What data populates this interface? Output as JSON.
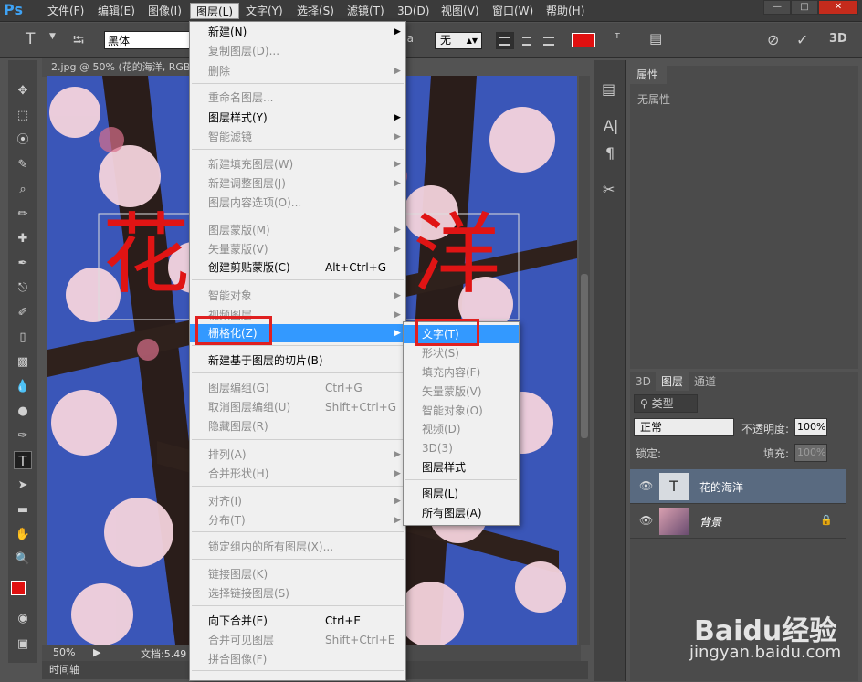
{
  "app": {
    "logo": "Ps"
  },
  "menubar": {
    "items": [
      "文件(F)",
      "编辑(E)",
      "图像(I)",
      "图层(L)",
      "文字(Y)",
      "选择(S)",
      "滤镜(T)",
      "3D(D)",
      "视图(V)",
      "窗口(W)",
      "帮助(H)"
    ]
  },
  "options": {
    "font_family": "黑体",
    "antialias": "无",
    "text_color": "#e01010",
    "glyph_aa": "ªa"
  },
  "document": {
    "tab_title": "2.jpg @ 50% (花的海洋, RGB",
    "zoom": "50%",
    "doc_info": "文档:5.49",
    "canvas_text_1": "花",
    "canvas_text_2": "洋"
  },
  "timeline": {
    "label": "时间轴"
  },
  "properties": {
    "tab": "属性",
    "empty": "无属性"
  },
  "layers": {
    "tabs": [
      "3D",
      "图层",
      "通道"
    ],
    "filter_kind": "类型",
    "blend_mode": "正常",
    "opacity_label": "不透明度:",
    "opacity": "100%",
    "lock_label": "锁定:",
    "fill_label": "填充:",
    "fill": "100%",
    "items": [
      {
        "name": "花的海洋",
        "thumb": "T"
      },
      {
        "name": "背景"
      }
    ]
  },
  "layer_menu": {
    "items": [
      {
        "label": "新建(N)",
        "arrow": true
      },
      {
        "label": "复制图层(D)...",
        "disabled": true
      },
      {
        "label": "删除",
        "disabled": true,
        "arrow": true
      },
      {
        "label": "重命名图层...",
        "disabled": true
      },
      {
        "label": "图层样式(Y)",
        "arrow": true
      },
      {
        "label": "智能滤镜",
        "disabled": true,
        "arrow": true
      },
      {
        "label": "新建填充图层(W)",
        "disabled": true,
        "arrow": true
      },
      {
        "label": "新建调整图层(J)",
        "disabled": true,
        "arrow": true
      },
      {
        "label": "图层内容选项(O)...",
        "disabled": true
      },
      {
        "label": "图层蒙版(M)",
        "disabled": true,
        "arrow": true
      },
      {
        "label": "矢量蒙版(V)",
        "disabled": true,
        "arrow": true
      },
      {
        "label": "创建剪贴蒙版(C)",
        "shortcut": "Alt+Ctrl+G"
      },
      {
        "label": "智能对象",
        "disabled": true,
        "arrow": true
      },
      {
        "label": "视频图层",
        "disabled": true,
        "arrow": true
      },
      {
        "label": "栅格化(Z)",
        "arrow": true,
        "highlight": true
      },
      {
        "label": "新建基于图层的切片(B)"
      },
      {
        "label": "图层编组(G)",
        "disabled": true,
        "shortcut": "Ctrl+G"
      },
      {
        "label": "取消图层编组(U)",
        "disabled": true,
        "shortcut": "Shift+Ctrl+G"
      },
      {
        "label": "隐藏图层(R)",
        "disabled": true
      },
      {
        "label": "排列(A)",
        "disabled": true,
        "arrow": true
      },
      {
        "label": "合并形状(H)",
        "disabled": true,
        "arrow": true
      },
      {
        "label": "对齐(I)",
        "disabled": true,
        "arrow": true
      },
      {
        "label": "分布(T)",
        "disabled": true,
        "arrow": true
      },
      {
        "label": "锁定组内的所有图层(X)...",
        "disabled": true
      },
      {
        "label": "链接图层(K)",
        "disabled": true
      },
      {
        "label": "选择链接图层(S)",
        "disabled": true
      },
      {
        "label": "向下合并(E)",
        "shortcut": "Ctrl+E"
      },
      {
        "label": "合并可见图层",
        "disabled": true,
        "shortcut": "Shift+Ctrl+E"
      },
      {
        "label": "拼合图像(F)",
        "disabled": true
      }
    ]
  },
  "rasterize_menu": {
    "items": [
      {
        "label": "文字(T)",
        "highlight": true
      },
      {
        "label": "形状(S)",
        "disabled": true
      },
      {
        "label": "填充内容(F)",
        "disabled": true
      },
      {
        "label": "矢量蒙版(V)",
        "disabled": true
      },
      {
        "label": "智能对象(O)",
        "disabled": true
      },
      {
        "label": "视频(D)",
        "disabled": true
      },
      {
        "label": "3D(3)",
        "disabled": true
      },
      {
        "label": "图层样式"
      },
      {
        "label": "图层(L)"
      },
      {
        "label": "所有图层(A)"
      }
    ]
  },
  "watermark": {
    "brand": "Baidu经验",
    "url": "jingyan.baidu.com"
  }
}
